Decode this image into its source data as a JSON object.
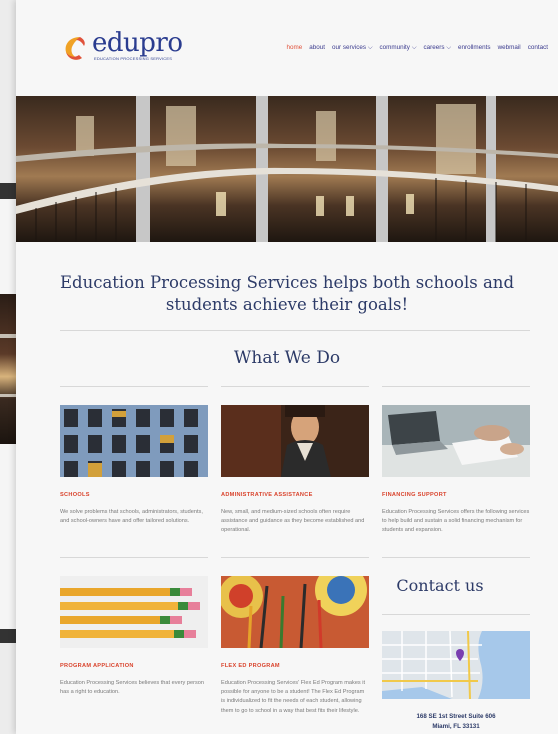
{
  "brand": {
    "name": "edupro",
    "tagline": "EDUCATION PROCESSING SERVICES",
    "color": "#2a3c8f",
    "accent": "#e0523b"
  },
  "nav": {
    "items": [
      {
        "label": "home",
        "active": true
      },
      {
        "label": "about"
      },
      {
        "label": "our services ⌵"
      },
      {
        "label": "community ⌵"
      },
      {
        "label": "careers ⌵"
      },
      {
        "label": "enrollments"
      },
      {
        "label": "webmail"
      },
      {
        "label": "contact"
      }
    ]
  },
  "intro": {
    "text": "Education Processing Services helps both schools and students achieve their goals!"
  },
  "what_we_do": {
    "title": "What We Do",
    "cards": [
      {
        "title": "SCHOOLS",
        "text": "We solve problems that schools, administrators, students, and school-owners have and offer tailored solutions.",
        "image": "building-facade-photo"
      },
      {
        "title": "ADMINISTRATIVE ASSISTANCE",
        "text": "New, small, and medium-sized schools often require assistance and guidance as they become established and operational.",
        "image": "businesswoman-photo"
      },
      {
        "title": "FINANCING SUPPORT",
        "text": "Education Processing Services offers the following services to help build and sustain a solid financing mechanism for students and expansion.",
        "image": "laptop-desk-photo"
      },
      {
        "title": "PROGRAM APPLICATION",
        "text": "Education Processing Services believes that every person has a right to education.",
        "image": "pencils-photo"
      },
      {
        "title": "FLEX ED PROGRAM",
        "text": "Education Processing Services' Flex Ed Program makes it possible for anyone to be a student! The Flex Ed Program is individualized to fit the needs of each student, allowing them to go to school in a way that best fits their lifestyle.",
        "image": "arrows-target-photo"
      }
    ]
  },
  "contact": {
    "title": "Contact us",
    "address_line1": "168 SE 1st Street  Suite 606",
    "address_line2": "Miami, FL 33131"
  }
}
